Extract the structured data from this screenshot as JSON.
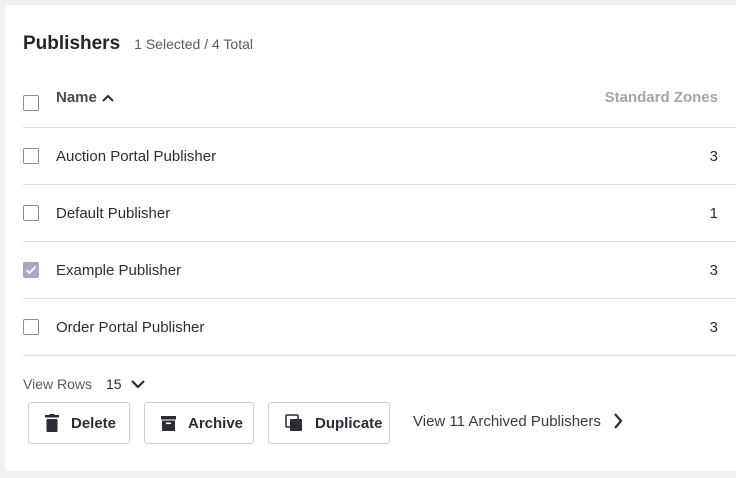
{
  "header": {
    "title": "Publishers",
    "count_text": "1 Selected / 4 Total"
  },
  "table": {
    "columns": {
      "name": "Name",
      "zones": "Standard Zones"
    },
    "sort": "ascending",
    "rows": [
      {
        "name": "Auction Portal Publisher",
        "zones": "3",
        "checked": false
      },
      {
        "name": "Default Publisher",
        "zones": "1",
        "checked": false
      },
      {
        "name": "Example Publisher",
        "zones": "3",
        "checked": true
      },
      {
        "name": "Order Portal Publisher",
        "zones": "3",
        "checked": false
      }
    ]
  },
  "pagination": {
    "label": "View Rows",
    "value": "15"
  },
  "actions": {
    "delete_label": "Delete",
    "archive_label": "Archive",
    "duplicate_label": "Duplicate",
    "archived_link": "View 11 Archived Publishers"
  },
  "icons": {
    "sort": "chevron-up-icon",
    "dropdown": "chevron-down-icon",
    "delete": "trash-icon",
    "archive": "archive-box-icon",
    "duplicate": "copy-icon",
    "link": "chevron-right-icon"
  },
  "colors": {
    "checked_checkbox": "#a7a9c0",
    "muted_header": "#a4a4b2",
    "divider": "#dcdce2"
  }
}
